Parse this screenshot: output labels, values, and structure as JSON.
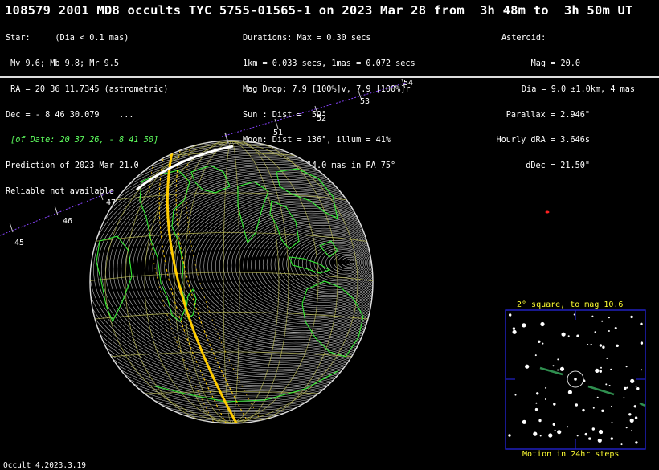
{
  "header": {
    "title": "108579 2001 MD8 occults TYC 5755-01565-1 on 2023 Mar 28 from  3h 48m to  3h 50m UT"
  },
  "star_info": {
    "line1": "Star:     (Dia < 0.1 mas)",
    "line2": " Mv 9.6; Mb 9.8; Mr 9.5",
    "line3": " RA = 20 36 11.7345 (astrometric)",
    "line4": "Dec = - 8 46 30.079    ...",
    "line5": " [of Date: 20 37 26, - 8 41 50]",
    "line6": "Prediction of 2023 Mar 21.0",
    "line7": "Reliable not available"
  },
  "event_info": {
    "line1": "Durations: Max = 0.30 secs",
    "line2": "1km = 0.033 secs, 1mas = 0.072 secs",
    "line3": "Mag Drop: 7.9 [100%]v, 7.9 [100%]r",
    "line4": "Sun : Dist =  59°",
    "line5": "Moon: Dist = 136°, illum = 41%",
    "line6": "Error 30.0 x 14.0 mas in PA 75°"
  },
  "asteroid_info": {
    "line1": "Asteroid:   ",
    "line2": "Mag = 20.0",
    "line3": "Dia = 9.0 ±1.0km, 4 mas",
    "line4": "Parallax = 2.946\"",
    "line5": "Hourly dRA = 3.646s",
    "line6": "dDec = 21.50\""
  },
  "path_ticks": [
    "45",
    "46",
    "47",
    "51",
    "52",
    "53",
    "54"
  ],
  "inset": {
    "title": "2° square, to mag 10.6",
    "footer": "Motion in 24hr steps"
  },
  "footer": {
    "version": "Occult 4.2023.3.19"
  },
  "colors": {
    "background": "#000000",
    "coastline": "#33ee33",
    "path_center": "#ffcc00",
    "grid": "#bbbb55",
    "inset_border": "#2222cc",
    "inset_text": "#ffff33",
    "track": "#8844ff",
    "motion": "#2f8f4f"
  }
}
